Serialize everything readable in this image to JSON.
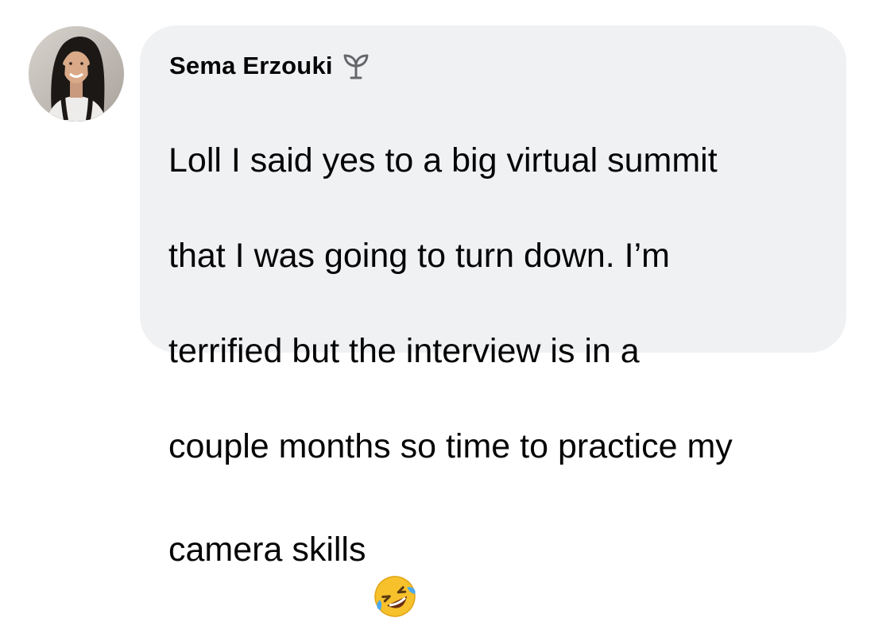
{
  "comment": {
    "author_name": "Sema Erzouki",
    "author_badge_icon": "sprout-badge-icon",
    "text_lines": [
      "Loll I said yes to a big virtual summit",
      "that I was going to turn down. I’m",
      "terrified but the interview is in a",
      "couple months so time to practice my",
      "camera skills"
    ],
    "emoji_icon": "rolling-on-floor-laughing-emoji",
    "bubble_color": "#f0f1f3",
    "text_color": "#050505",
    "badge_color": "#65676b"
  }
}
